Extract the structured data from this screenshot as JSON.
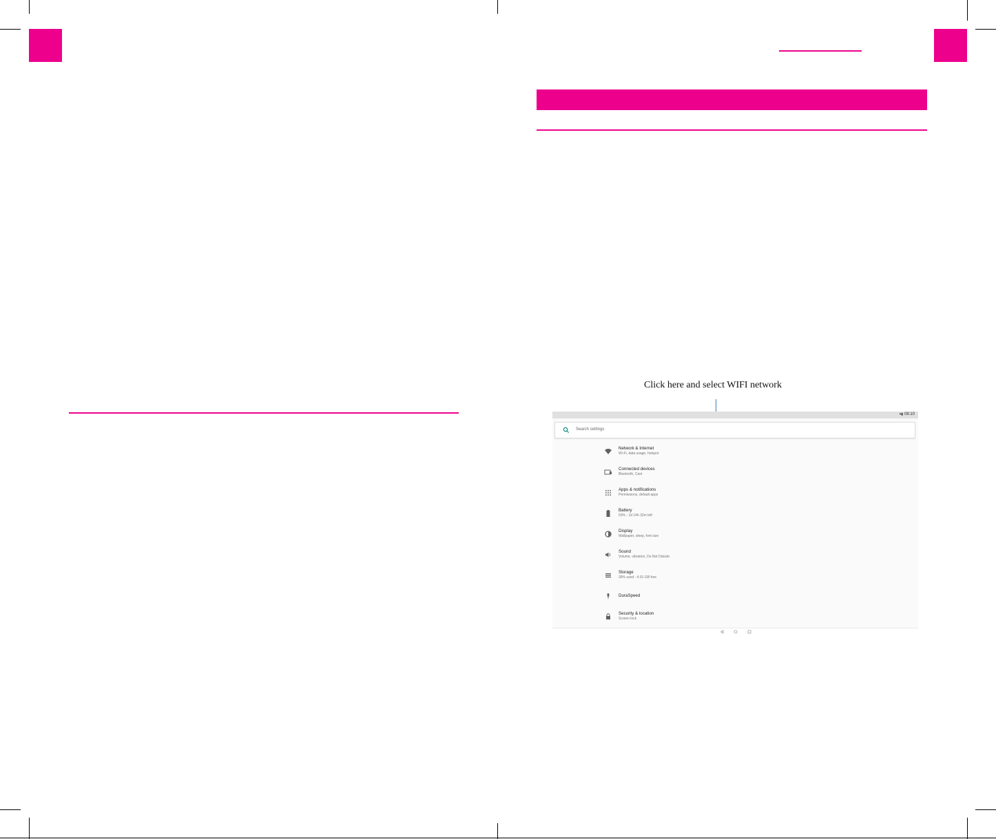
{
  "colors": {
    "accent": "#ec008c",
    "callout": "#3d7fb8"
  },
  "annotation": "Click here and select WIFI network",
  "device": {
    "status_time": "08:10",
    "search_placeholder": "Search settings",
    "items": [
      {
        "icon": "wifi-icon",
        "title": "Network & Internet",
        "subtitle": "Wi-Fi, data usage, hotspot"
      },
      {
        "icon": "connected-devices-icon",
        "title": "Connected devices",
        "subtitle": "Bluetooth, Cast"
      },
      {
        "icon": "apps-grid-icon",
        "title": "Apps & notifications",
        "subtitle": "Permissions, default apps"
      },
      {
        "icon": "battery-icon",
        "title": "Battery",
        "subtitle": "53% - 1d 14h 32m left"
      },
      {
        "icon": "display-brightness-icon",
        "title": "Display",
        "subtitle": "Wallpaper, sleep, font size"
      },
      {
        "icon": "volume-icon",
        "title": "Sound",
        "subtitle": "Volume, vibration, Do Not Disturb"
      },
      {
        "icon": "storage-icon",
        "title": "Storage",
        "subtitle": "39% used - 4.91 GB free"
      },
      {
        "icon": "microphone-icon",
        "title": "DuraSpeed",
        "subtitle": ""
      },
      {
        "icon": "lock-icon",
        "title": "Security & location",
        "subtitle": "Screen lock"
      }
    ]
  }
}
